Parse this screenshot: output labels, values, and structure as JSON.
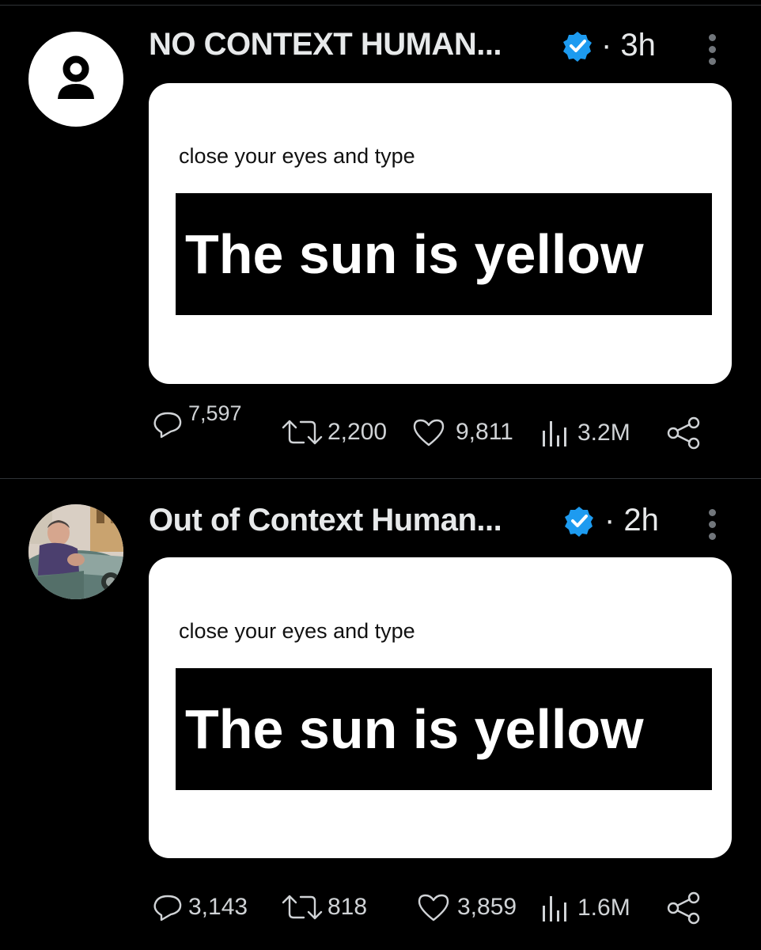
{
  "tweets": [
    {
      "author": "NO CONTEXT HUMAN...",
      "time": "· 3h",
      "avatar": "default-profile-icon",
      "image": {
        "caption": "close your eyes and type",
        "headline": "The sun is yellow"
      },
      "stats": {
        "replies": "7,597",
        "reposts": "2,200",
        "likes": "9,811",
        "views": "3.2M"
      }
    },
    {
      "author": "Out of Context Human...",
      "time": "· 2h",
      "avatar": "profile-photo-man-in-car",
      "image": {
        "caption": "close your eyes and type",
        "headline": "The sun is yellow"
      },
      "stats": {
        "replies": "3,143",
        "reposts": "818",
        "likes": "3,859",
        "views": "1.6M"
      }
    }
  ],
  "colors": {
    "background": "#000000",
    "text": "#e7e9ea",
    "muted": "#71767b",
    "verified": "#1d9bf0",
    "divider": "#2f3336"
  },
  "icons": [
    "verified-badge-icon",
    "more-options-icon",
    "reply-icon",
    "repost-icon",
    "like-icon",
    "views-icon",
    "share-icon"
  ]
}
